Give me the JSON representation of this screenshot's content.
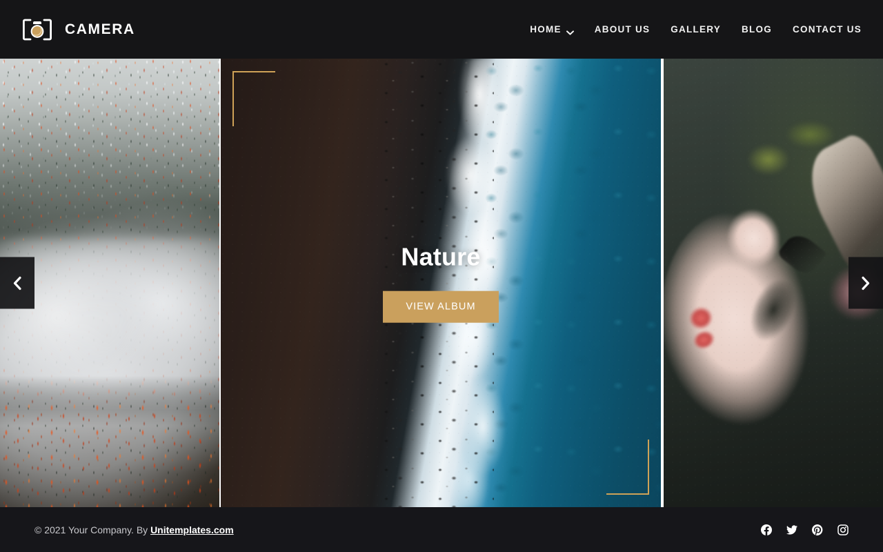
{
  "header": {
    "brand": {
      "name": "CAMERA",
      "logo_icon": "camera-logo-icon",
      "accent_color": "#caa05d"
    },
    "nav": [
      {
        "label": "HOME",
        "has_dropdown": true,
        "icon": "chevron-down-icon"
      },
      {
        "label": "ABOUT US",
        "has_dropdown": false
      },
      {
        "label": "GALLERY",
        "has_dropdown": false
      },
      {
        "label": "BLOG",
        "has_dropdown": false
      },
      {
        "label": "CONTACT US",
        "has_dropdown": false
      }
    ],
    "background_color": "#151517"
  },
  "slider": {
    "prev_icon": "chevron-left-icon",
    "next_icon": "chevron-right-icon",
    "frame_color": "#cfa257",
    "slides": [
      {
        "position": "left",
        "alt": "foggy autumn forest with snow dusted pines"
      },
      {
        "position": "center",
        "alt": "aerial view of rocky coastline with breaking surf and blue ocean",
        "active": true
      },
      {
        "position": "right",
        "alt": "moody portrait of a woman in profile among leaves"
      }
    ],
    "caption": {
      "title": "Nature",
      "button_label": "VIEW ALBUM",
      "button_color": "#caa05d"
    }
  },
  "footer": {
    "copyright_prefix": "© 2021 Your Company. By ",
    "site_name": "Unitemplates.com",
    "background_color": "#16161a",
    "socials": [
      {
        "name": "facebook",
        "icon": "facebook-icon"
      },
      {
        "name": "twitter",
        "icon": "twitter-icon"
      },
      {
        "name": "pinterest",
        "icon": "pinterest-icon"
      },
      {
        "name": "instagram",
        "icon": "instagram-icon"
      }
    ]
  }
}
